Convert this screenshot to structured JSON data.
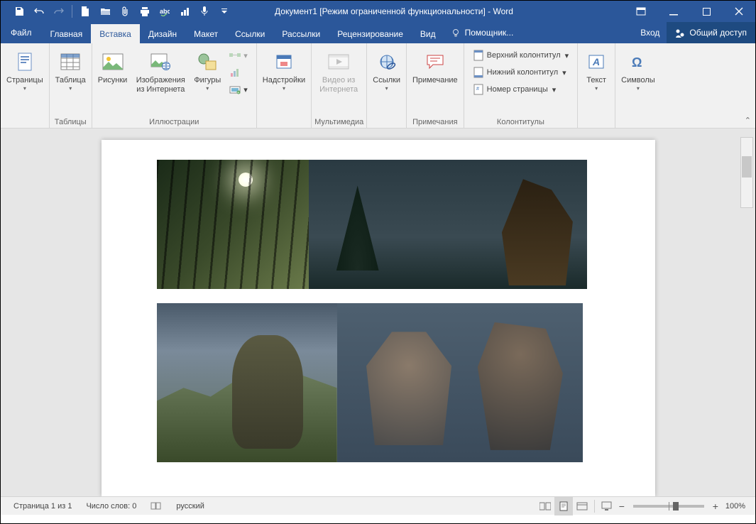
{
  "title": "Документ1 [Режим ограниченной функциональности] - Word",
  "tabs": {
    "file": "Файл",
    "items": [
      "Главная",
      "Вставка",
      "Дизайн",
      "Макет",
      "Ссылки",
      "Рассылки",
      "Рецензирование",
      "Вид"
    ],
    "activeIndex": 1,
    "tellMe": "Помощник...",
    "signIn": "Вход",
    "share": "Общий доступ"
  },
  "ribbon": {
    "pages": {
      "label": "Страницы",
      "dropdown": true,
      "groupLabel": ""
    },
    "tableGroup": {
      "label": "Таблицы",
      "table": "Таблица"
    },
    "illustrations": {
      "label": "Иллюстрации",
      "pictures": "Рисунки",
      "onlinePictures": "Изображения из Интернета",
      "shapes": "Фигуры"
    },
    "addins": {
      "label": "",
      "addins": "Надстройки"
    },
    "media": {
      "label": "Мультимедиа",
      "onlineVideo": "Видео из Интернета"
    },
    "links": {
      "label": "",
      "links": "Ссылки"
    },
    "comments": {
      "label": "Примечания",
      "comment": "Примечание"
    },
    "headerFooter": {
      "label": "Колонтитулы",
      "header": "Верхний колонтитул",
      "footer": "Нижний колонтитул",
      "pageNumber": "Номер страницы"
    },
    "text": {
      "label": "",
      "text": "Текст"
    },
    "symbols": {
      "label": "",
      "symbols": "Символы"
    }
  },
  "statusbar": {
    "page": "Страница 1 из 1",
    "words": "Число слов: 0",
    "language": "русский",
    "zoom": "100%"
  }
}
